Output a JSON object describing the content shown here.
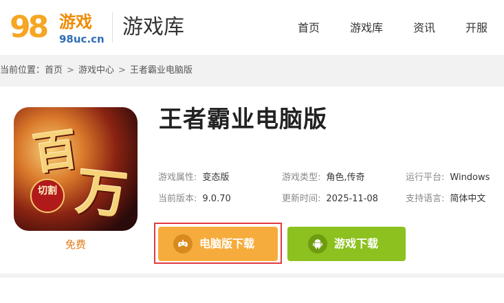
{
  "header": {
    "logo_number": "98",
    "logo_name": "游戏",
    "logo_site": "98uc.cn",
    "section_title": "游戏库",
    "nav": [
      "首页",
      "游戏库",
      "资讯",
      "开服"
    ]
  },
  "breadcrumb": {
    "label": "当前位置：",
    "items": [
      "首页",
      "游戏中心",
      "王者霸业电脑版"
    ],
    "separator": ">"
  },
  "game": {
    "title": "王者霸业电脑版",
    "icon_text": [
      "百",
      "万"
    ],
    "icon_seal": "切割",
    "price_label": "免费",
    "info": [
      {
        "key": "游戏属性:",
        "value": "变态版"
      },
      {
        "key": "游戏类型:",
        "value": "角色,传奇"
      },
      {
        "key": "运行平台:",
        "value": "Windows"
      },
      {
        "key": "当前版本:",
        "value": "9.0.70"
      },
      {
        "key": "更新时间:",
        "value": "2025-11-08"
      },
      {
        "key": "支持语言:",
        "value": "简体中文"
      }
    ]
  },
  "buttons": {
    "pc_download": "电脑版下载",
    "game_download": "游戏下载",
    "pc_icon": "gamepad-icon",
    "game_icon": "android-icon"
  },
  "colors": {
    "pc_button": "#f6ac3c",
    "game_button": "#8cc11f",
    "highlight_frame": "#e0393e",
    "price": "#e07a15"
  }
}
